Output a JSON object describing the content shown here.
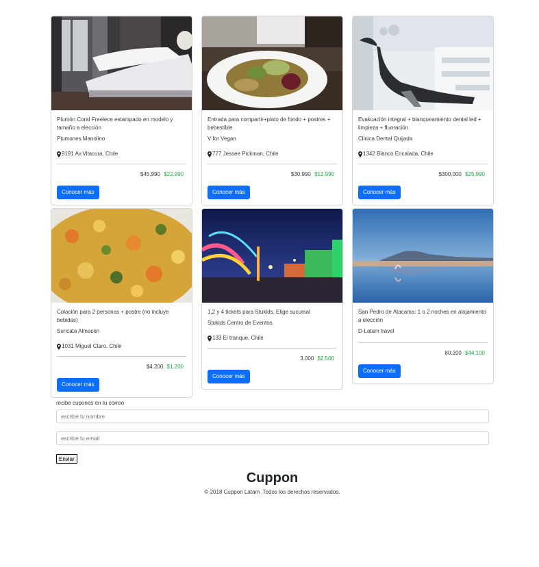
{
  "cards": [
    {
      "title": "Plumón Coral Freelece estampado en modelo y tamaño a elección",
      "merchant": "Plumones Manolino",
      "location": "9191 Av.Vitacura, Chile",
      "old_price": "$45.990",
      "new_price": "$22.990",
      "cta": "Conocer más",
      "image": "bedroom-photo"
    },
    {
      "title": "Entrada para compartir+plato de fondo + postres + bebestible",
      "merchant": "V for Vegan",
      "location": "777 Jessee Pickman, Chile",
      "old_price": "$30.990",
      "new_price": "$12.990",
      "cta": "Conocer más",
      "image": "vegan-dish-photo"
    },
    {
      "title": "Evakuación integral + blanqueamiento dental led + limpieza + fluoración",
      "merchant": "Clinica Dental Quijada",
      "location": "1342 Blanco Encalada, Chile",
      "old_price": "$300.000",
      "new_price": "$25.990",
      "cta": "Conocer más",
      "image": "dental-chair-photo"
    },
    {
      "title": "Colación para 2 personas + postre (no incluye bebidas)",
      "merchant": "Suricata Almacén",
      "location": "1031 Miguel Claro, Chile",
      "old_price": "$4.200",
      "new_price": "$1.200",
      "cta": "Conocer más",
      "image": "food-photo"
    },
    {
      "title": "1,2 y 4 tickets para Stukids. Elige sucursal",
      "merchant": "Stukids Centro de Eventos",
      "location": "133 El tranque, Chile",
      "old_price": "3.000",
      "new_price": "$2.500",
      "cta": "Conocer más",
      "image": "fair-night-photo"
    },
    {
      "title": "San Pedro de Atacama: 1 o 2 noches en alojamiento a elección",
      "merchant": "D-Latam travel",
      "location": "",
      "old_price": "80.200",
      "new_price": "$44.100",
      "cta": "Conocer más",
      "image": "atacama-lake-photo"
    }
  ],
  "subscribe": {
    "label": "recibe cupones en tu correo",
    "name_placeholder": "escribe tu nombre",
    "email_placeholder": "escribe tu email",
    "button": "Enviar"
  },
  "footer": {
    "brand": "Cuppon",
    "copyright": "© 2018 Cuppon Latam .Todos los derechos reservados."
  },
  "colors": {
    "primary": "#0d6efd",
    "discount_green": "#28a745"
  }
}
